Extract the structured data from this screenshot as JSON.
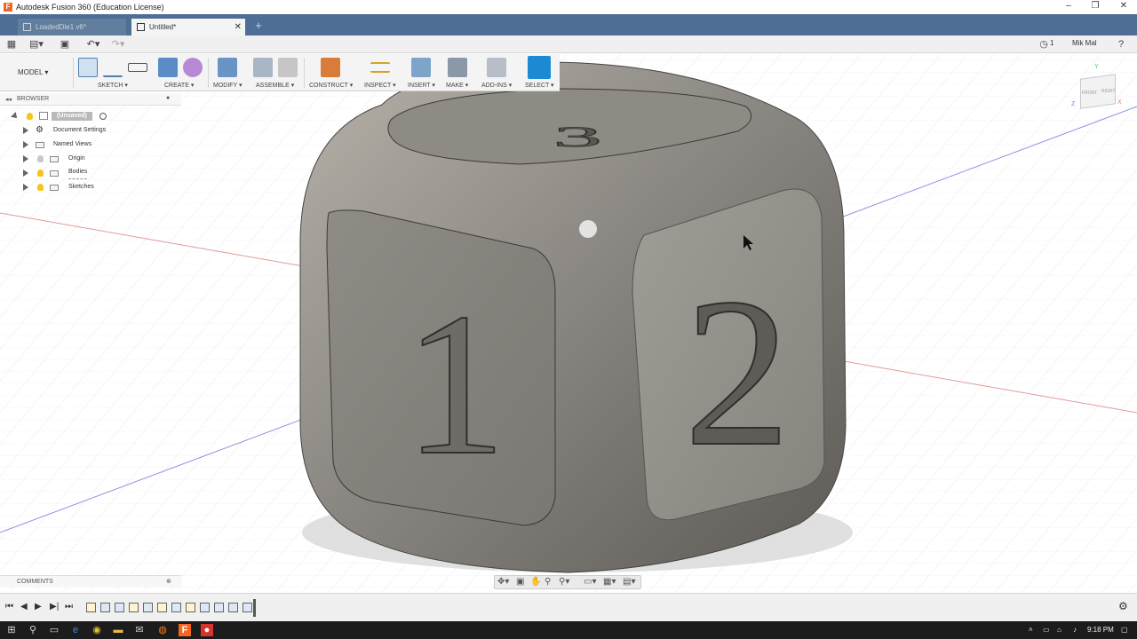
{
  "window": {
    "title": "Autodesk Fusion 360 (Education License)"
  },
  "tabs": [
    {
      "label": "LoadedDie1 v6*",
      "active": false
    },
    {
      "label": "Untitled*",
      "active": true
    }
  ],
  "quickaccess": {
    "job_count": "1",
    "user": "Mik Mal"
  },
  "ribbon": {
    "mode": "MODEL",
    "groups": {
      "sketch": "SKETCH",
      "create": "CREATE",
      "modify": "MODIFY",
      "assemble": "ASSEMBLE",
      "construct": "CONSTRUCT",
      "inspect": "INSPECT",
      "insert": "INSERT",
      "make": "MAKE",
      "addins": "ADD-INS",
      "select": "SELECT"
    }
  },
  "browser": {
    "title": "BROWSER",
    "root": "(Unsaved)",
    "items": [
      {
        "label": "Document Settings"
      },
      {
        "label": "Named Views"
      },
      {
        "label": "Origin"
      },
      {
        "label": "Bodies"
      },
      {
        "label": "Sketches"
      }
    ]
  },
  "comments": {
    "title": "COMMENTS"
  },
  "viewcube": {
    "front": "FRONT",
    "right": "RIGHT",
    "axis_z": "Z",
    "axis_y": "Y",
    "axis_x": "X"
  },
  "model": {
    "top_face_number": "3",
    "front_face_number": "1",
    "right_face_number": "2"
  },
  "taskbar": {
    "time": "9:18 PM"
  },
  "colors": {
    "tab_bar": "#4f6e96",
    "select_accent": "#1b8ad3",
    "body_metal": "#8a8782"
  }
}
